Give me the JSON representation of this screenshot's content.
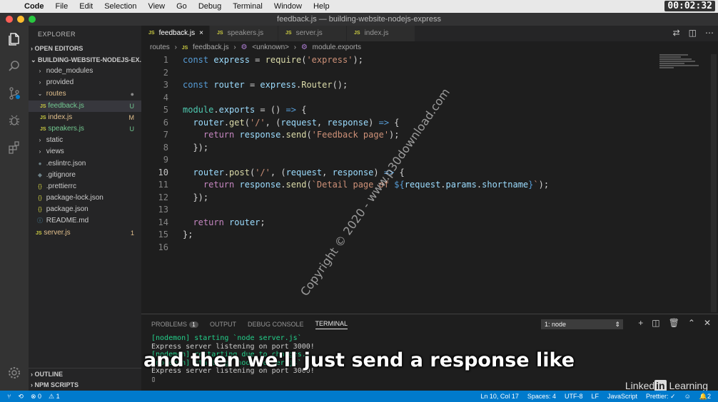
{
  "menubar": {
    "items": [
      "Code",
      "File",
      "Edit",
      "Selection",
      "View",
      "Go",
      "Debug",
      "Terminal",
      "Window",
      "Help"
    ],
    "timer": "00:02:32"
  },
  "window": {
    "title": "feedback.js — building-website-nodejs-express"
  },
  "explorer": {
    "title": "EXPLORER",
    "open_editors": "OPEN EDITORS",
    "project": "BUILDING-WEBSITE-NODEJS-EX...",
    "items": [
      {
        "label": "node_modules",
        "badge": ""
      },
      {
        "label": "provided",
        "badge": ""
      },
      {
        "label": "routes",
        "badge": "●"
      },
      {
        "label": "feedback.js",
        "badge": "U"
      },
      {
        "label": "index.js",
        "badge": "M"
      },
      {
        "label": "speakers.js",
        "badge": "U"
      },
      {
        "label": "static",
        "badge": ""
      },
      {
        "label": "views",
        "badge": ""
      },
      {
        "label": ".eslintrc.json",
        "badge": ""
      },
      {
        "label": ".gitignore",
        "badge": ""
      },
      {
        "label": ".prettierrc",
        "badge": ""
      },
      {
        "label": "package-lock.json",
        "badge": ""
      },
      {
        "label": "package.json",
        "badge": ""
      },
      {
        "label": "README.md",
        "badge": ""
      },
      {
        "label": "server.js",
        "badge": "1"
      }
    ],
    "outline": "OUTLINE",
    "npm_scripts": "NPM SCRIPTS"
  },
  "tabs": [
    {
      "label": "feedback.js",
      "close": "×"
    },
    {
      "label": "speakers.js"
    },
    {
      "label": "server.js"
    },
    {
      "label": "index.js"
    }
  ],
  "breadcrumb": [
    "routes",
    "›",
    "feedback.js",
    "›",
    "<unknown>",
    "›",
    "module.exports"
  ],
  "editor": {
    "line_numbers": [
      "1",
      "2",
      "3",
      "4",
      "5",
      "6",
      "7",
      "8",
      "9",
      "10",
      "11",
      "12",
      "13",
      "14",
      "15",
      "16"
    ]
  },
  "watermark": "Copyright © 2020 - www.p30download.com",
  "panel": {
    "tabs": [
      "PROBLEMS",
      "OUTPUT",
      "DEBUG CONSOLE",
      "TERMINAL"
    ],
    "problems_count": "1",
    "terminal_select": "1: node",
    "terminal_lines": [
      "[nodemon] starting `node server.js`",
      "Express server listening on port 3000!",
      "[nodemon] restarting due to changes...",
      "[nodemon] starting `node server.js`",
      "Express server listening on port 3000!",
      "▯"
    ]
  },
  "subtitle": "and then we'll just send a response like",
  "watermark_brand": {
    "prefix": "Linked",
    "in": "in",
    "suffix": " Learning"
  },
  "statusbar": {
    "errors": "⊗ 0",
    "warnings": "⚠ 1",
    "position": "Ln 10, Col 17",
    "spaces": "Spaces: 4",
    "encoding": "UTF-8",
    "eol": "LF",
    "language": "JavaScript",
    "prettier": "Prettier: ✓",
    "bell_count": "2"
  }
}
